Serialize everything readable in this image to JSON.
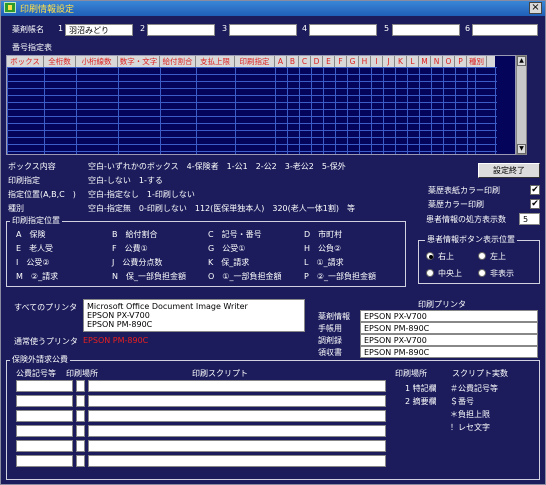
{
  "window": {
    "title": "印刷情報設定",
    "close": "×"
  },
  "herbs": {
    "label": "薬剤帳名",
    "fields": [
      {
        "num": "1",
        "value": "羽沼みどり"
      },
      {
        "num": "2",
        "value": ""
      },
      {
        "num": "3",
        "value": ""
      },
      {
        "num": "4",
        "value": ""
      },
      {
        "num": "5",
        "value": ""
      },
      {
        "num": "6",
        "value": ""
      }
    ]
  },
  "table": {
    "title": "番号指定表",
    "columns": [
      "ボックス",
      "全桁数",
      "小桁線数",
      "数字・文字",
      "給付割合",
      "支払上限",
      "印刷指定",
      "A",
      "B",
      "C",
      "D",
      "E",
      "F",
      "G",
      "H",
      "I",
      "J",
      "K",
      "L",
      "M",
      "N",
      "O",
      "P",
      "種別"
    ]
  },
  "legend": {
    "rows": [
      {
        "label": "ボックス内容",
        "text": "空白-いずれかのボックス　4-保険者　1-公1　2-公2　3-老公2　5-保外"
      },
      {
        "label": "印刷指定",
        "text": "空白-しない　1-する"
      },
      {
        "label": "指定位置(A,B,C　)",
        "text": "空白-指定なし　1-印刷しない"
      },
      {
        "label": "種別",
        "text": "空白-指定無　0-印刷しない　112(医保単独本人)　320(老人一体1割)　等"
      }
    ]
  },
  "settings": {
    "done_button": "設定終了",
    "color_print_label": "薬歴表紙カラー印刷",
    "color_print2_label": "薬歴カラー印刷",
    "color_print_checked": "✔",
    "color_print2_checked": "✔",
    "rx_count_label": "患者情報の処方表示数",
    "rx_count_value": "5"
  },
  "positions": {
    "title": "印刷指定位置",
    "items": [
      {
        "k": "A",
        "v": "保険"
      },
      {
        "k": "B",
        "v": "給付割合"
      },
      {
        "k": "C",
        "v": "記号・番号"
      },
      {
        "k": "D",
        "v": "市町村"
      },
      {
        "k": "E",
        "v": "老人受"
      },
      {
        "k": "F",
        "v": "公費①"
      },
      {
        "k": "G",
        "v": "公受①"
      },
      {
        "k": "H",
        "v": "公負②"
      },
      {
        "k": "I",
        "v": "公受②"
      },
      {
        "k": "J",
        "v": "公費分点数"
      },
      {
        "k": "K",
        "v": "保_請求"
      },
      {
        "k": "L",
        "v": "①_請求"
      },
      {
        "k": "M",
        "v": "②_請求"
      },
      {
        "k": "N",
        "v": "保_一部負担金額"
      },
      {
        "k": "O",
        "v": "①_一部負担金額"
      },
      {
        "k": "P",
        "v": "②_一部負担金額"
      }
    ]
  },
  "button_pos": {
    "title": "患者情報ボタン表示位置",
    "opt1": "右上",
    "opt2": "左上",
    "opt3": "中央上",
    "opt4": "非表示"
  },
  "printers": {
    "all_label": "すべてのプリンタ",
    "all_list": [
      "Microsoft Office Document Image Writer",
      "EPSON PX-V700",
      "EPSON PM-890C"
    ],
    "default_label": "通常使うプリンタ",
    "default_value": "EPSON PM-890C",
    "print_printer_title": "印刷プリンタ",
    "assign": [
      {
        "label": "薬剤情報",
        "value": "EPSON PX-V700"
      },
      {
        "label": "手帳用",
        "value": "EPSON PM-890C"
      },
      {
        "label": "調剤録",
        "value": "EPSON PX-V700"
      },
      {
        "label": "領収書",
        "value": "EPSON PM-890C"
      }
    ]
  },
  "claims": {
    "title": "保険外請求公費",
    "col1": "公費記号等",
    "col2": "印刷場所",
    "col3": "印刷スクリプト",
    "right_title1": "印刷場所",
    "right_title2": "スクリプト実数",
    "places": [
      "1 特記欄",
      "2 摘要欄"
    ],
    "scripts": [
      "＃公費記号等",
      "＄番号",
      "＊負担上限",
      "！レセ文字"
    ]
  }
}
